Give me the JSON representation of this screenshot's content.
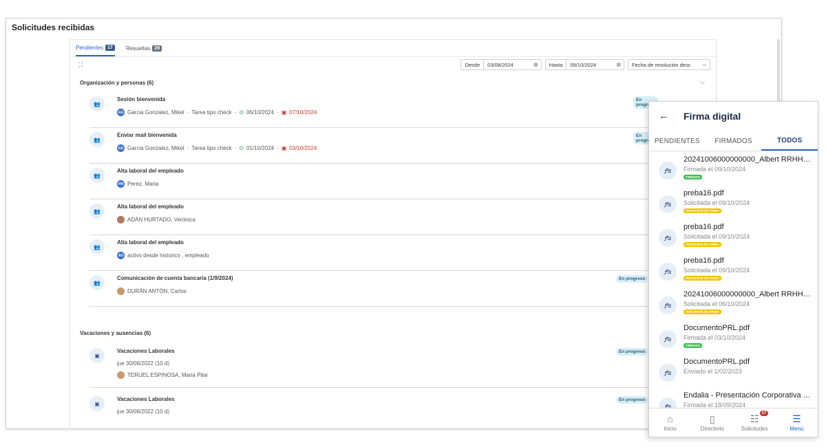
{
  "page": {
    "title": "Solicitudes recibidas"
  },
  "tabs": [
    {
      "label": "Pendientes",
      "count": "17"
    },
    {
      "label": "Resueltas",
      "count": "29"
    }
  ],
  "filters": {
    "desde_label": "Desde",
    "desde_value": "03/08/2024",
    "hasta_label": "Hasta",
    "hasta_value": "09/10/2024",
    "sort_value": "Fecha de resolución desc"
  },
  "sections": {
    "org": "Organización y personas (6)",
    "vac": "Vacaciones y ausencias (6)"
  },
  "rows": [
    {
      "title": "Sesión bienvenida",
      "initials": "GG",
      "person": "Garcia Gonzalez, Mikel",
      "type": "Tarea tipo check",
      "start": "06/10/2024",
      "due": "07/10/2024",
      "status": "En progreso"
    },
    {
      "title": "Enviar mail bienvenida",
      "initials": "GG",
      "person": "Garcia Gonzalez, Mikel",
      "type": "Tarea tipo check",
      "start": "01/10/2024",
      "due": "03/10/2024",
      "status": "En progreso"
    },
    {
      "title": "Alta laboral del empleado",
      "initials": "PM",
      "person": "Perez, Maria"
    },
    {
      "title": "Alta laboral del empleado",
      "person": "ADÁN HURTADO, Verónica"
    },
    {
      "title": "Alta laboral del empleado",
      "initials": "AD",
      "person": "activo desde historico , empleado"
    },
    {
      "title": "Comunicación de cuenta bancaria (1/9/2024)",
      "person": "DURÁN ANTÓN, Carlos",
      "status": "En progreso"
    }
  ],
  "vac_rows": [
    {
      "title": "Vacaciones Laborales",
      "date": "jue 30/06/2022 (10 d)",
      "person": "TERUEL ESPINOSA, Maria Pilar",
      "status": "En progreso"
    },
    {
      "title": "Vacaciones Laborales",
      "date": "jue 30/06/2022 (10 d)",
      "status": "En progreso"
    }
  ],
  "mobile": {
    "title": "Firma digital",
    "tabs": [
      "PENDIENTES",
      "FIRMADOS",
      "TODOS"
    ],
    "items": [
      {
        "name": "20241006000000000_Albert RRHH ...",
        "date": "Firmada el 09/10/2024",
        "badge": "FIRMADO",
        "color": "green"
      },
      {
        "name": "preba16.pdf",
        "date": "Solicitada el 09/10/2024",
        "badge": "PENDIENTE DE FIRMA",
        "color": "yellow"
      },
      {
        "name": "preba16.pdf",
        "date": "Solicitada el 09/10/2024",
        "badge": "PENDIENTE DE FIRMA",
        "color": "yellow"
      },
      {
        "name": "preba16.pdf",
        "date": "Solicitada el 09/10/2024",
        "badge": "PENDIENTE DE FIRMA",
        "color": "yellow"
      },
      {
        "name": "20241006000000000_Albert RRHH ...",
        "date": "Solicitada el 06/10/2024",
        "badge": "PENDIENTE DE FIRMA",
        "color": "yellow"
      },
      {
        "name": "DocumentoPRL.pdf",
        "date": "Firmada el 03/10/2024",
        "badge": "FIRMADO",
        "color": "green"
      },
      {
        "name": "DocumentoPRL.pdf",
        "date": "Enviado el 1/02/2023"
      },
      {
        "name": "Endalia - Presentación Corporativa 2...",
        "date": "Firmada el 18/09/2024"
      }
    ],
    "nav": [
      {
        "label": "Inicio",
        "icon": "home-icon"
      },
      {
        "label": "Directorio",
        "icon": "directory-icon"
      },
      {
        "label": "Solicitudes",
        "icon": "requests-icon",
        "count": "17"
      },
      {
        "label": "Menú",
        "icon": "menu-icon"
      }
    ]
  }
}
